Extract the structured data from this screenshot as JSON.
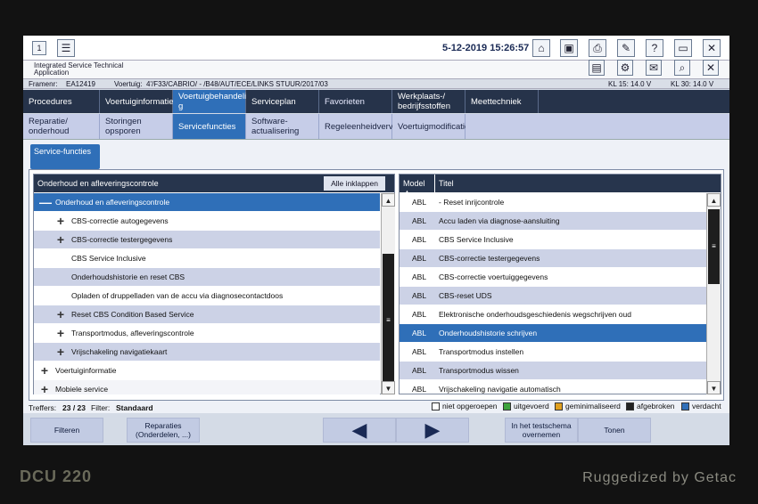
{
  "device": {
    "model": "DCU 220",
    "brand_tagline": "Ruggedized by Getac"
  },
  "topbar": {
    "datetime": "5-12-2019 15:26:57",
    "window_number": "1"
  },
  "app": {
    "name": "Integrated Service Technical Application"
  },
  "infobar": {
    "framenr_label": "Framenr:",
    "framenr": "EA12419",
    "voertuig_label": "Voertuig:",
    "voertuig": "4'/F33/CABRIO/ - /B48/AUT/ECE/LINKS STUUR/2017/03",
    "kl15": "KL 15:  14.0 V",
    "kl30": "KL 30:  14.0 V"
  },
  "tabs_main": [
    {
      "label": "Procedures"
    },
    {
      "label": "Voertuiginformatie"
    },
    {
      "label": "Voertuigbehandelin g"
    },
    {
      "label": "Serviceplan"
    },
    {
      "label": "Favorieten"
    },
    {
      "label": "Werkplaats-/ bedrijfsstoffen"
    },
    {
      "label": "Meettechniek"
    }
  ],
  "tabs_sub": [
    {
      "label": "Reparatie/ onderhoud"
    },
    {
      "label": "Storingen opsporen"
    },
    {
      "label": "Servicefuncties"
    },
    {
      "label": "Software-actualisering"
    },
    {
      "label": "Regeleenheidvervanging"
    },
    {
      "label": "Voertuigmodificatie"
    }
  ],
  "subtab": {
    "label": "Service-functies"
  },
  "tree": {
    "header": "Onderhoud en afleveringscontrole",
    "collapse_all": "Alle inklappen",
    "rows": [
      {
        "label": "Onderhoud en afleveringscontrole",
        "icon": "minus"
      },
      {
        "label": "CBS-correctie autogegevens",
        "icon": "plus"
      },
      {
        "label": "CBS-correctie testergegevens",
        "icon": "plus"
      },
      {
        "label": "CBS Service Inclusive",
        "icon": "none"
      },
      {
        "label": "Onderhoudshistorie en reset CBS",
        "icon": "none"
      },
      {
        "label": "Opladen of druppelladen van de accu via diagnosecontactdoos",
        "icon": "none"
      },
      {
        "label": "Reset CBS Condition Based Service",
        "icon": "plus"
      },
      {
        "label": "Transportmodus, afleveringscontrole",
        "icon": "plus"
      },
      {
        "label": "Vrijschakeling navigatiekaart",
        "icon": "plus"
      },
      {
        "label": "Voertuiginformatie",
        "icon": "plus"
      },
      {
        "label": "Mobiele service",
        "icon": "plus"
      }
    ]
  },
  "table": {
    "col_model": "Model ▲",
    "col_title": "Titel",
    "rows": [
      {
        "model": "ABL",
        "title": "- Reset inrijcontrole"
      },
      {
        "model": "ABL",
        "title": "Accu laden via diagnose-aansluiting"
      },
      {
        "model": "ABL",
        "title": "CBS Service Inclusive"
      },
      {
        "model": "ABL",
        "title": "CBS-correctie testergegevens"
      },
      {
        "model": "ABL",
        "title": "CBS-correctie voertuiggegevens"
      },
      {
        "model": "ABL",
        "title": "CBS-reset UDS"
      },
      {
        "model": "ABL",
        "title": "Elektronische onderhoudsgeschiedenis wegschrijven oud"
      },
      {
        "model": "ABL",
        "title": "Onderhoudshistorie schrijven"
      },
      {
        "model": "ABL",
        "title": "Transportmodus instellen"
      },
      {
        "model": "ABL",
        "title": "Transportmodus wissen"
      },
      {
        "model": "ABL",
        "title": "Vrijschakeling navigatie automatisch"
      }
    ]
  },
  "status": {
    "treffers_label": "Treffers:",
    "treffers": "23 / 23",
    "filter_label": "Filter:",
    "filter": "Standaard"
  },
  "legend": [
    {
      "label": "niet opgeroepen",
      "color": "#ffffff"
    },
    {
      "label": "uitgevoerd",
      "color": "#3da33d"
    },
    {
      "label": "geminimaliseerd",
      "color": "#e0a020"
    },
    {
      "label": "afgebroken",
      "color": "#222222"
    },
    {
      "label": "verdacht",
      "color": "#2f6fb8"
    }
  ],
  "buttons": {
    "filter": "Filteren",
    "repairs": "Reparaties (Onderdelen, ...)",
    "test_plan": "In het testschema overnemen",
    "show": "Tonen"
  },
  "scrollbar": {
    "thumb_glyph": "≡",
    "up": "▲",
    "down": "▼"
  },
  "colors": {
    "accent": "#2f6fb8",
    "header": "#27354d",
    "alt_row": "#ccd2e6"
  }
}
